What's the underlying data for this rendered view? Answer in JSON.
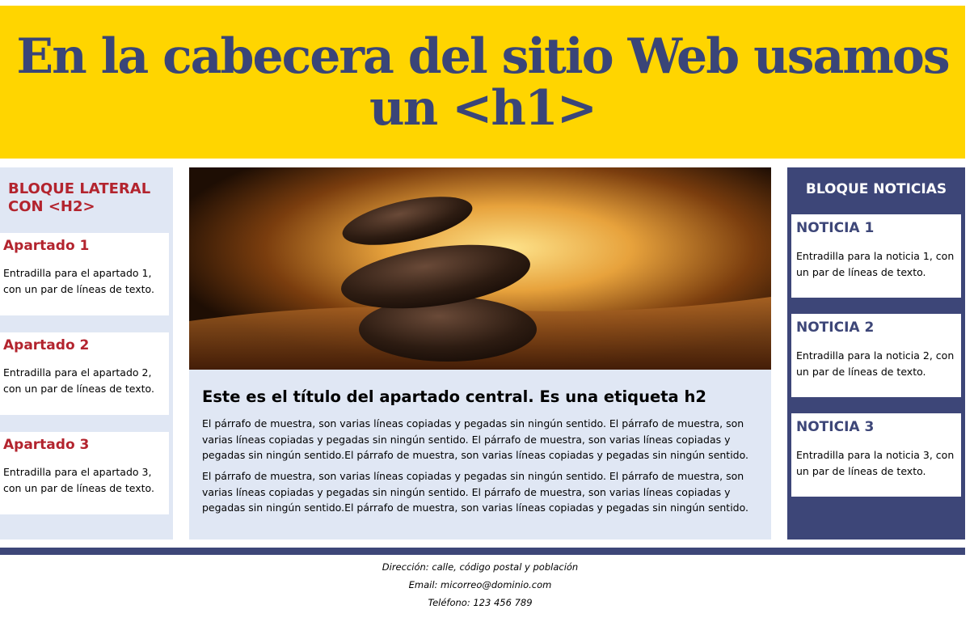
{
  "header": {
    "title": "En la cabecera del sitio Web usamos un <h1>"
  },
  "left_sidebar": {
    "title": "BLOQUE LATERAL CON <H2>",
    "sections": [
      {
        "heading": "Apartado 1",
        "text": "Entradilla para el apartado 1, con un par de líneas de texto."
      },
      {
        "heading": "Apartado 2",
        "text": "Entradilla para el apartado 2, con un par de líneas de texto."
      },
      {
        "heading": "Apartado 3",
        "text": "Entradilla para el apartado 3, con un par de líneas de texto."
      }
    ]
  },
  "main": {
    "image": "stacked-stones-photo",
    "title": "Este es el título del apartado central. Es una etiqueta h2",
    "paragraphs": [
      "El párrafo de muestra, son varias líneas copiadas y pegadas sin ningún sentido. El párrafo de muestra, son varias líneas copiadas y pegadas sin ningún sentido. El párrafo de muestra, son varias líneas copiadas y pegadas sin ningún sentido.El párrafo de muestra, son varias líneas copiadas y pegadas sin ningún sentido.",
      "El párrafo de muestra, son varias líneas copiadas y pegadas sin ningún sentido. El párrafo de muestra, son varias líneas copiadas y pegadas sin ningún sentido. El párrafo de muestra, son varias líneas copiadas y pegadas sin ningún sentido.El párrafo de muestra, son varias líneas copiadas y pegadas sin ningún sentido."
    ]
  },
  "news_sidebar": {
    "title": "BLOQUE NOTICIAS",
    "items": [
      {
        "heading": "NOTICIA 1",
        "text": "Entradilla para la noticia 1, con un par de líneas de texto."
      },
      {
        "heading": "NOTICIA 2",
        "text": "Entradilla para la noticia 2, con un par de líneas de texto."
      },
      {
        "heading": "NOTICIA 3",
        "text": "Entradilla para la noticia 3, con un par de líneas de texto."
      }
    ]
  },
  "footer": {
    "address": "Dirección: calle, código postal y población",
    "email": "Email: micorreo@dominio.com",
    "phone": "Teléfono: 123 456 789"
  },
  "colors": {
    "header_bg": "#ffd500",
    "header_text": "#3a4578",
    "sidebar_bg": "#e0e7f4",
    "accent_red": "#b3242e",
    "navy": "#3d4678"
  }
}
